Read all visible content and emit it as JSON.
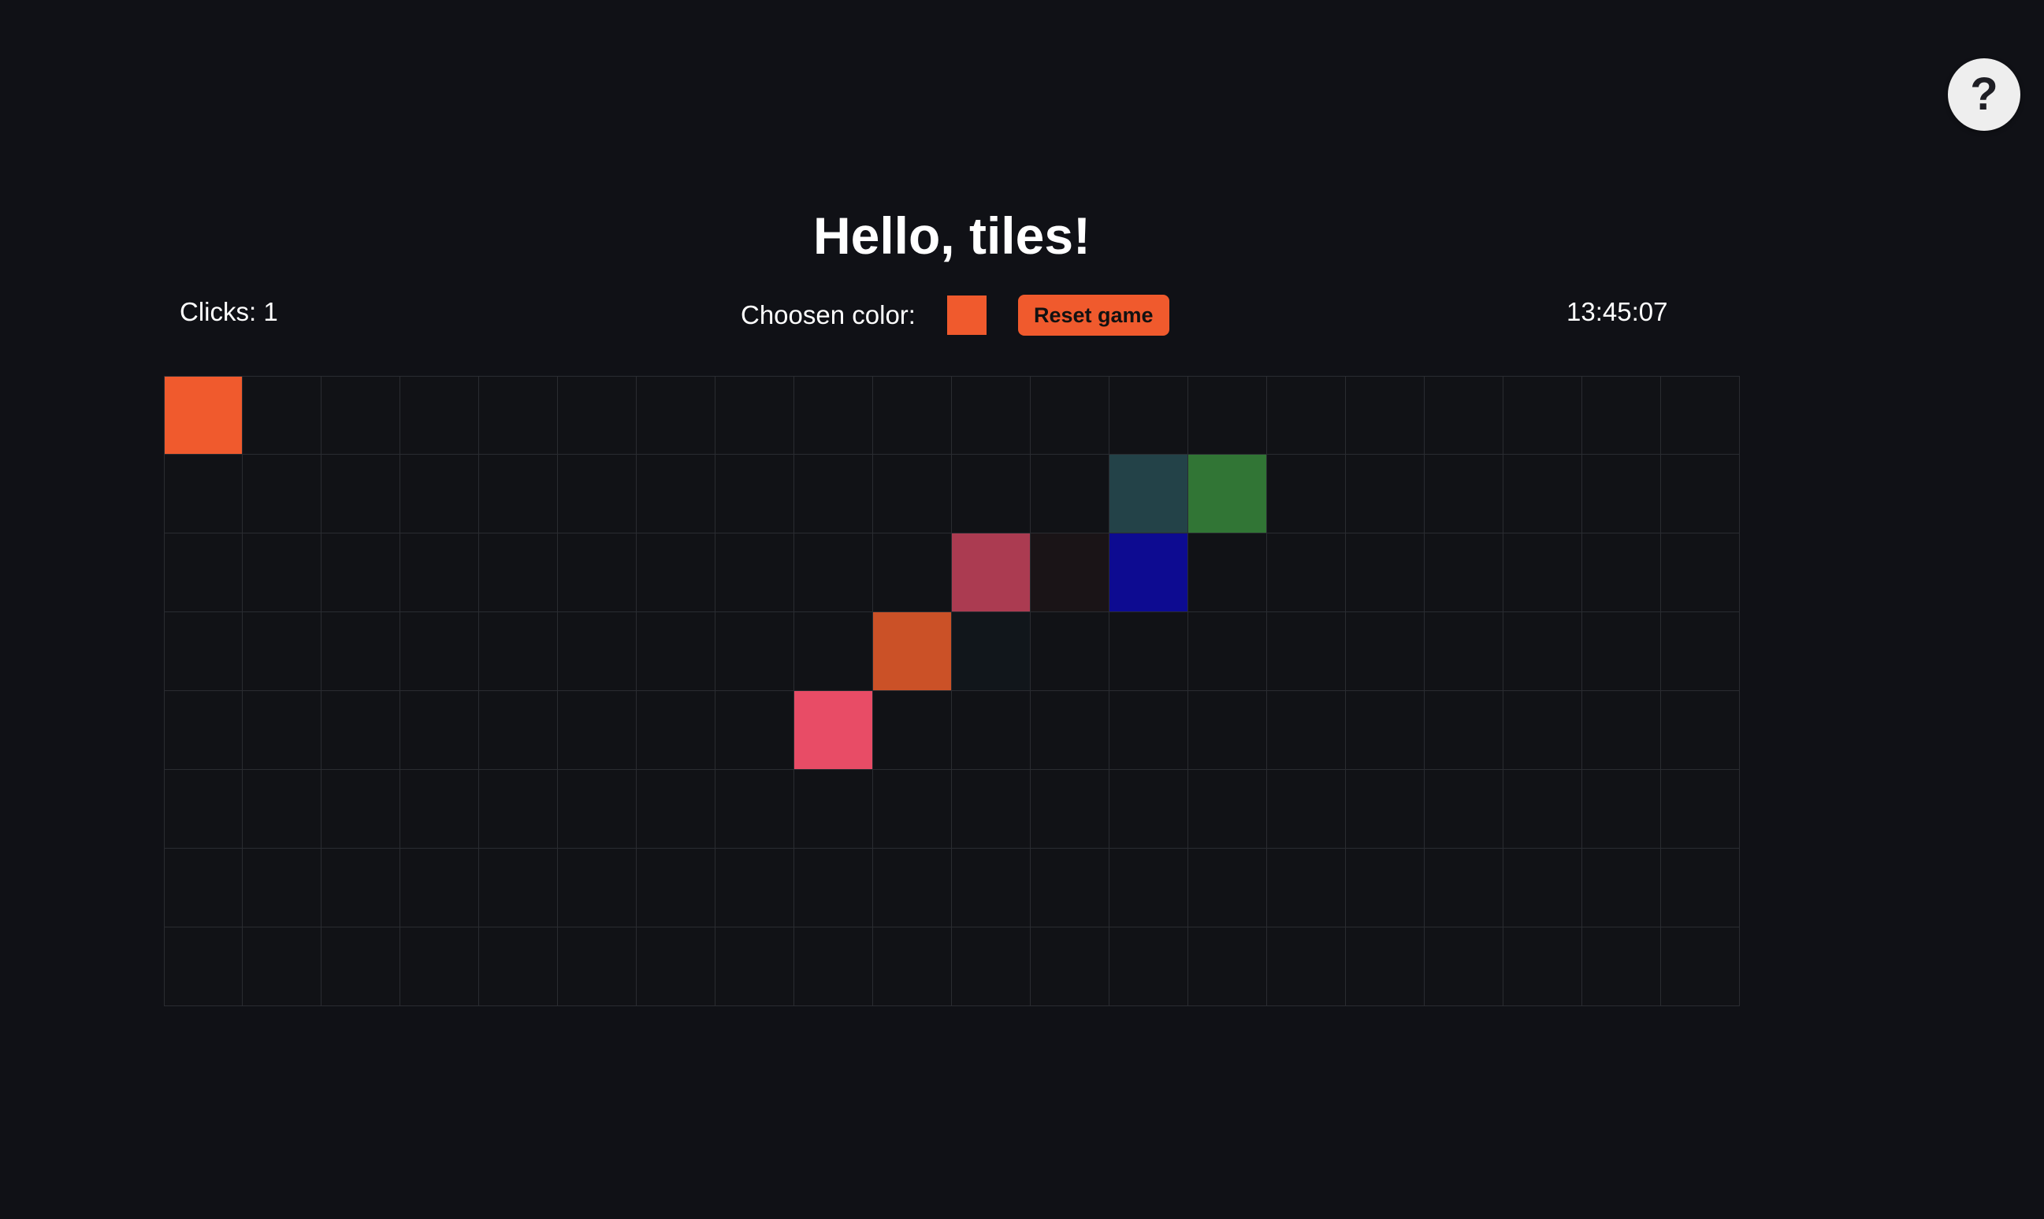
{
  "page": {
    "title": "Hello, tiles!"
  },
  "help": {
    "label": "?"
  },
  "stats": {
    "clicks_text": "Clicks: 1",
    "time": "13:45:07"
  },
  "color_picker": {
    "label": "Choosen color:",
    "chosen_color": "#f05a2d"
  },
  "reset": {
    "label": "Reset game",
    "color": "#f05a2d"
  },
  "board": {
    "rows": 8,
    "cols": 20,
    "empty_color": "#111216",
    "painted": [
      {
        "row": 0,
        "col": 0,
        "color": "#f05a2d"
      },
      {
        "row": 1,
        "col": 12,
        "color": "#234248"
      },
      {
        "row": 1,
        "col": 13,
        "color": "#317535"
      },
      {
        "row": 2,
        "col": 10,
        "color": "#ab3b51"
      },
      {
        "row": 2,
        "col": 11,
        "color": "#1a1417"
      },
      {
        "row": 2,
        "col": 12,
        "color": "#0d0b91"
      },
      {
        "row": 3,
        "col": 9,
        "color": "#cb5127"
      },
      {
        "row": 3,
        "col": 10,
        "color": "#11161b"
      },
      {
        "row": 4,
        "col": 8,
        "color": "#e84c66"
      }
    ]
  }
}
